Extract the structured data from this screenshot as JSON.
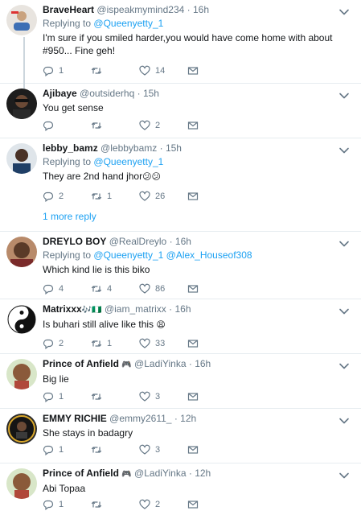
{
  "tweets": [
    {
      "name": "BraveHeart",
      "name_emoji": "",
      "handle": "@ispeakmymind234",
      "dot": "·",
      "time": "16h",
      "replying_label": "Replying to",
      "mention1": "@Queenyetty_1",
      "mention2": "",
      "text": "I'm sure if you smiled harder,you would have come home with about #950... Fine geh!",
      "text_emoji": "",
      "reply_count": "1",
      "retweet_count": "",
      "like_count": "14",
      "icons": [
        "reply-icon",
        "retweet-icon",
        "like-icon",
        "message-icon",
        "chevron-down-icon"
      ]
    },
    {
      "name": "Ajibaye",
      "name_emoji": "",
      "handle": "@outsiderhq",
      "dot": "·",
      "time": "15h",
      "text": "You get sense",
      "text_emoji": "",
      "reply_count": "",
      "retweet_count": "",
      "like_count": "2"
    },
    {
      "name": "lebby_bamz",
      "name_emoji": "",
      "handle": "@lebbybamz",
      "dot": "·",
      "time": "15h",
      "replying_label": "Replying to",
      "mention1": "@Queenyetty_1",
      "mention2": "",
      "text": "They are 2nd hand jhor",
      "text_emoji": "😕😕",
      "reply_count": "2",
      "retweet_count": "1",
      "like_count": "26",
      "more_replies": "1 more reply"
    },
    {
      "name": "DREYLO BOY",
      "name_emoji": "",
      "handle": "@RealDreylo",
      "dot": "·",
      "time": "16h",
      "replying_label": "Replying to",
      "mention1": "@Queenyetty_1",
      "mention2": "@Alex_Houseof308",
      "text": "Which kind lie is this biko",
      "text_emoji": "",
      "reply_count": "4",
      "retweet_count": "4",
      "like_count": "86"
    },
    {
      "name": "Matrixxx",
      "name_emoji": "🎶🇳🇬",
      "handle": "@iam_matrixx",
      "dot": "·",
      "time": "16h",
      "text": "Is buhari still alive like this",
      "text_emoji": "😩",
      "reply_count": "2",
      "retweet_count": "1",
      "like_count": "33"
    },
    {
      "name": "Prince of Anfield",
      "name_emoji": "🎮",
      "handle": "@LadiYinka",
      "dot": "·",
      "time": "16h",
      "text": "Big lie",
      "text_emoji": "",
      "reply_count": "1",
      "retweet_count": "",
      "like_count": "3"
    },
    {
      "name": "EMMY RICHIE",
      "name_emoji": "",
      "handle": "@emmy2611_",
      "dot": "·",
      "time": "12h",
      "text": "She stays in badagry",
      "text_emoji": "",
      "reply_count": "1",
      "retweet_count": "",
      "like_count": "3"
    },
    {
      "name": "Prince of Anfield",
      "name_emoji": "🎮",
      "handle": "@LadiYinka",
      "dot": "·",
      "time": "12h",
      "text": "Abi Topaa",
      "text_emoji": "",
      "reply_count": "1",
      "retweet_count": "",
      "like_count": "2"
    }
  ],
  "colors": {
    "accent": "#1da1f2",
    "secondary_text": "#657786",
    "divider": "#e6ecf0",
    "thread_line": "#ccd6dd"
  }
}
